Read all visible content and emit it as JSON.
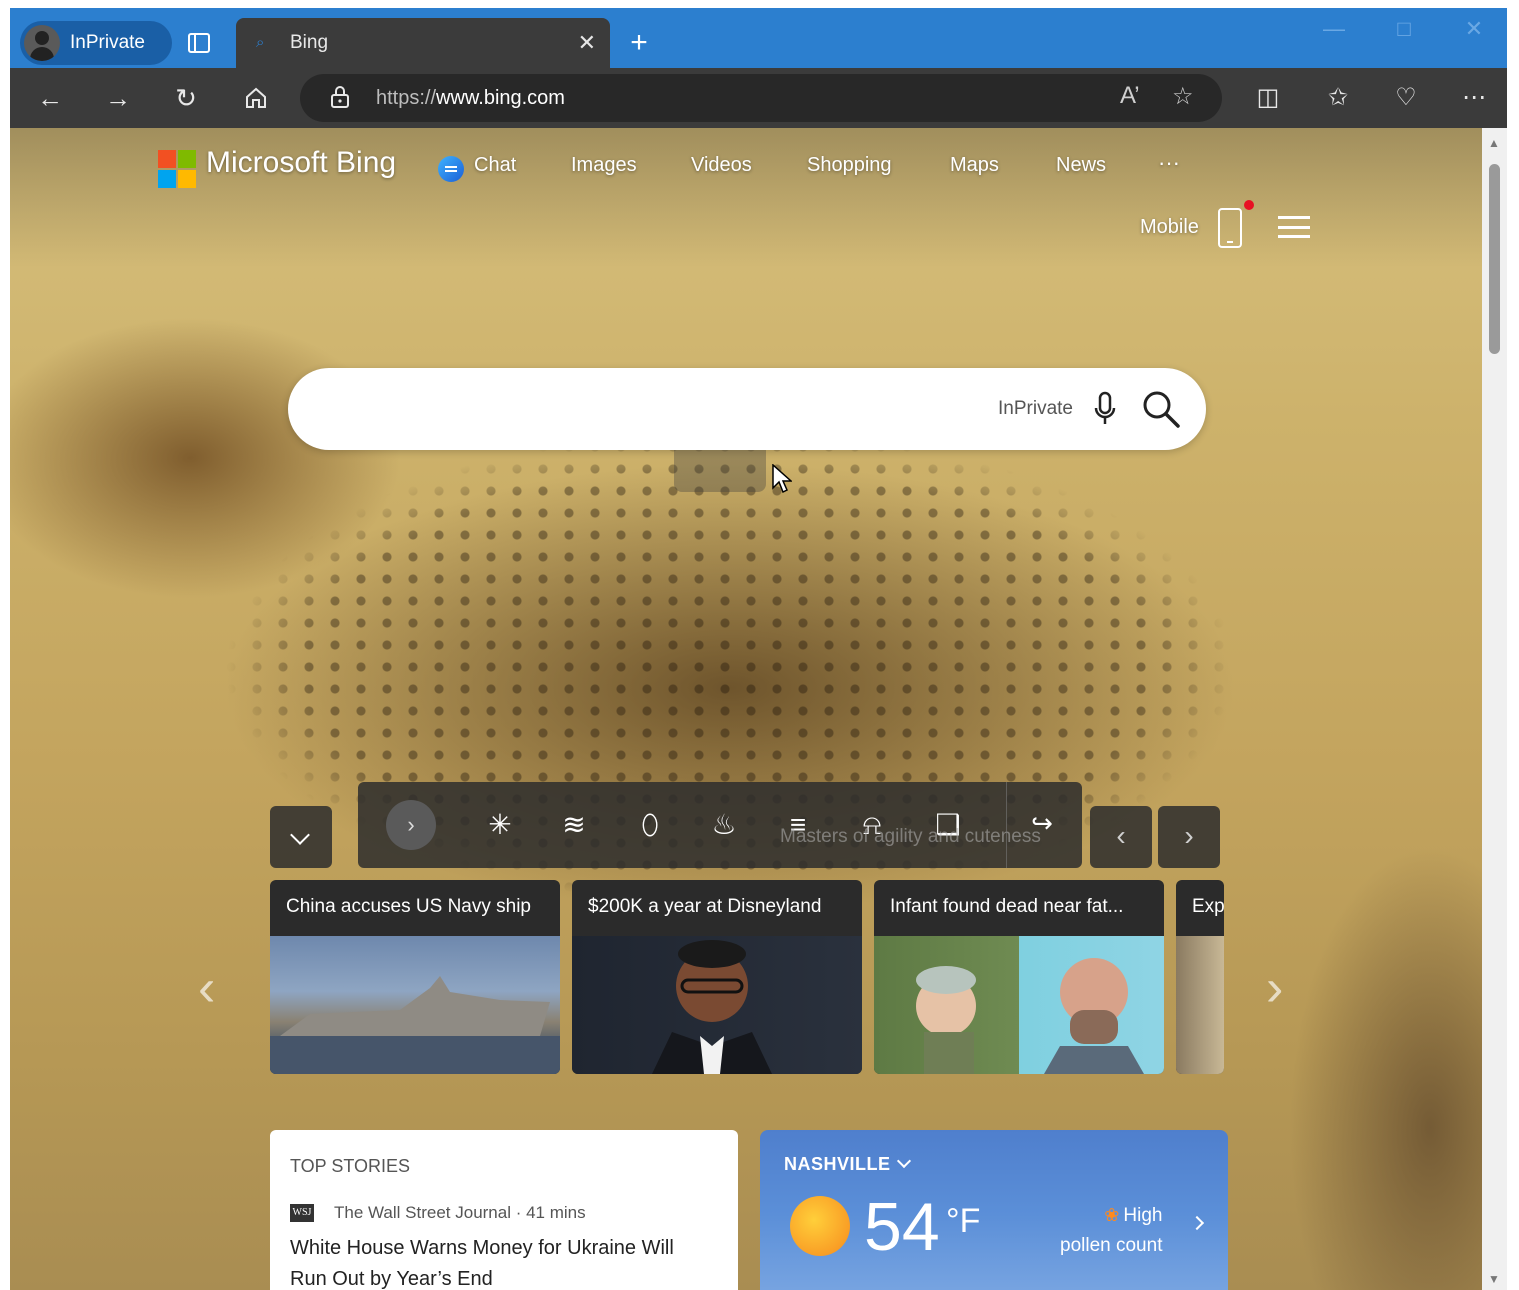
{
  "browser": {
    "profile_label": "InPrivate",
    "tab_title": "Bing",
    "url_prefix": "https://",
    "url_host": "www.bing.com"
  },
  "bing": {
    "brand": "Microsoft Bing",
    "nav": [
      "Chat",
      "Images",
      "Videos",
      "Shopping",
      "Maps",
      "News",
      "···"
    ],
    "mobile_label": "Mobile",
    "search": {
      "value": "",
      "inprivate_label": "InPrivate"
    },
    "image_caption": "Masters of agility and cuteness"
  },
  "news_cards": [
    {
      "title": "China accuses US Navy ship"
    },
    {
      "title": "$200K a year at Disneyland"
    },
    {
      "title": "Infant found dead near fat..."
    },
    {
      "title": "Exp"
    }
  ],
  "top_stories": {
    "heading": "TOP STORIES",
    "source_logo": "WSJ",
    "source": "The Wall Street Journal · 41 mins",
    "headline": "White House Warns Money for Ukraine Will Run Out by Year’s End"
  },
  "weather": {
    "city": "NASHVILLE",
    "temperature": "54",
    "unit": "°F",
    "pollen_level": "High",
    "pollen_label": "pollen count"
  },
  "colors": {
    "tabbar": "#2c7fcf",
    "toolbar": "#3b3b3b",
    "weather_card": "#5b8fd8"
  }
}
